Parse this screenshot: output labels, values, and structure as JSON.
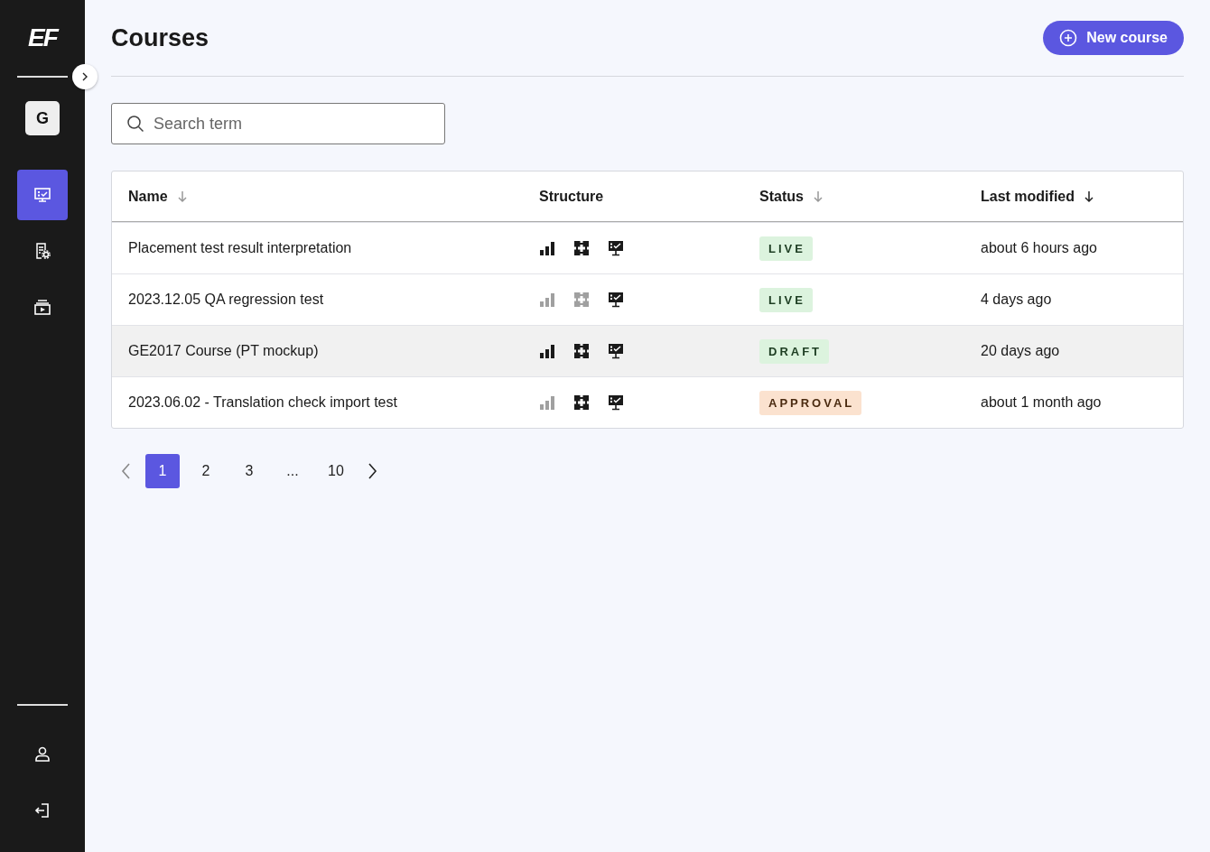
{
  "sidebar": {
    "logo": "EF",
    "avatar": "G",
    "nav": [
      {
        "kind": "monitor",
        "selected": true
      },
      {
        "kind": "settings-doc",
        "selected": false
      },
      {
        "kind": "media",
        "selected": false
      }
    ],
    "bottom": [
      {
        "kind": "user"
      },
      {
        "kind": "logout"
      }
    ]
  },
  "header": {
    "title": "Courses",
    "new_button": "New course"
  },
  "search": {
    "placeholder": "Search term"
  },
  "table": {
    "columns": [
      {
        "label": "Name",
        "sorted": false
      },
      {
        "label": "Structure"
      },
      {
        "label": "Status",
        "sorted": false
      },
      {
        "label": "Last modified",
        "sorted": true
      }
    ],
    "rows": [
      {
        "name": "Placement test result interpretation",
        "structure": {
          "levels": true,
          "modules": true,
          "lessons": true
        },
        "status": {
          "label": "LIVE",
          "kind": "live"
        },
        "modified": "about 6 hours ago",
        "highlighted": false
      },
      {
        "name": "2023.12.05 QA regression test",
        "structure": {
          "levels": false,
          "modules": false,
          "lessons": true
        },
        "status": {
          "label": "LIVE",
          "kind": "live"
        },
        "modified": "4 days ago",
        "highlighted": false
      },
      {
        "name": "GE2017 Course (PT mockup)",
        "structure": {
          "levels": true,
          "modules": true,
          "lessons": true
        },
        "status": {
          "label": "DRAFT",
          "kind": "draft"
        },
        "modified": "20 days ago",
        "highlighted": true
      },
      {
        "name": "2023.06.02 - Translation check import test",
        "structure": {
          "levels": false,
          "modules": true,
          "lessons": true
        },
        "status": {
          "label": "APPROVAL",
          "kind": "approval"
        },
        "modified": "about 1 month ago",
        "highlighted": false
      }
    ]
  },
  "pagination": {
    "pages": [
      {
        "label": "1",
        "selected": true
      },
      {
        "label": "2",
        "selected": false
      },
      {
        "label": "3",
        "selected": false
      },
      {
        "label": "...",
        "selected": false
      },
      {
        "label": "10",
        "selected": false
      }
    ]
  }
}
